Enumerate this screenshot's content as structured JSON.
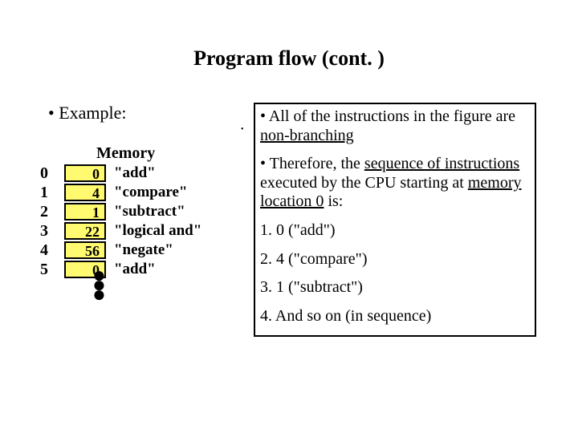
{
  "title": "Program flow (cont. )",
  "example_label": "•   Example:",
  "memory_header": "Memory",
  "memory": [
    {
      "addr": "0",
      "val": "0",
      "mnemonic": "\"add\""
    },
    {
      "addr": "1",
      "val": "4",
      "mnemonic": "\"compare\""
    },
    {
      "addr": "2",
      "val": "1",
      "mnemonic": "\"subtract\""
    },
    {
      "addr": "3",
      "val": "22",
      "mnemonic": "\"logical and\""
    },
    {
      "addr": "4",
      "val": "56",
      "mnemonic": "\"negate\""
    },
    {
      "addr": "5",
      "val": "0",
      "mnemonic": "\"add\""
    }
  ],
  "info": {
    "p1_a": "• All of the instructions in the figure are ",
    "p1_u": "non-branching",
    "p2_a": "• Therefore, the ",
    "p2_u1": "sequence of instructions",
    "p2_b": " executed by the CPU starting at ",
    "p2_u2": "memory location 0",
    "p2_c": " is:",
    "l1": "1. 0 (\"add\")",
    "l2": "2. 4 (\"compare\")",
    "l3": "3. 1 (\"subtract\")",
    "l4": "4. And so on (in sequence)"
  }
}
